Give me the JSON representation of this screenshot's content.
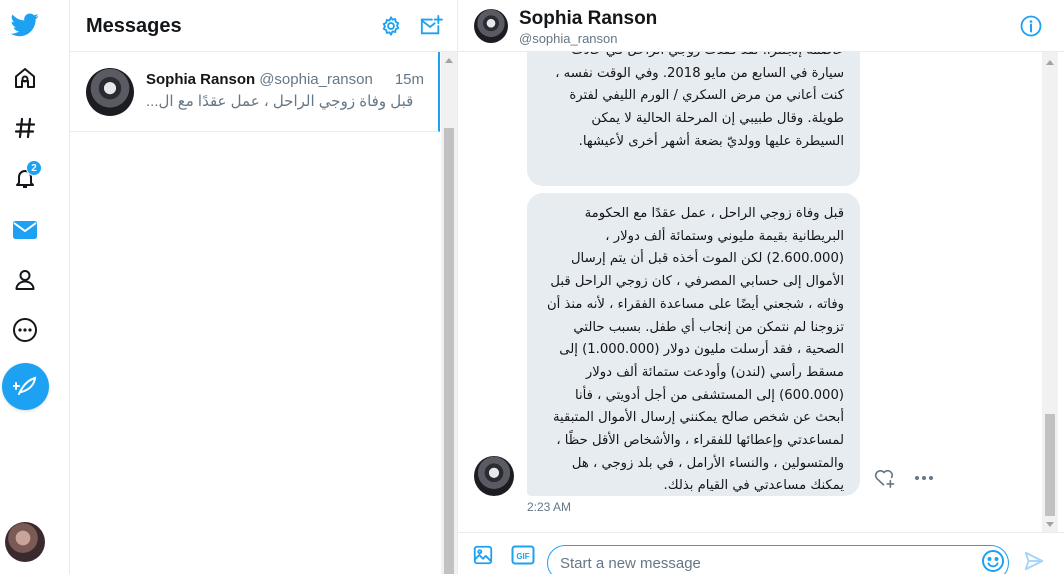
{
  "nav": {
    "items": [
      {
        "icon": "twitter-logo-icon"
      },
      {
        "icon": "home-icon"
      },
      {
        "icon": "hashtag-explore-icon"
      },
      {
        "icon": "notifications-bell-icon",
        "badge": "2"
      },
      {
        "icon": "messages-envelope-icon"
      },
      {
        "icon": "profile-person-icon"
      },
      {
        "icon": "more-options-icon"
      }
    ],
    "compose_icon": "compose-tweet-icon"
  },
  "list": {
    "title": "Messages",
    "settings_icon": "gear-icon",
    "new_message_icon": "new-message-icon"
  },
  "conversation": {
    "name": "Sophia Ranson",
    "handle": "@sophia_ranson",
    "time": "15m",
    "preview": "قبل وفاة زوجي الراحل ، عمل عقدًا مع ال..."
  },
  "chat": {
    "name": "Sophia Ranson",
    "handle": "@sophia_ranson",
    "info_icon": "info-icon",
    "messages": [
      {
        "text": "عاصمة إنجلترا. لقد فقدت زوجي الراحل في حادث سيارة في السابع من مايو 2018. وفي الوقت نفسه ، كنت أعاني من مرض السكري / الورم الليفي لفترة طويلة. وقال طبيبي إن المرحلة الحالية لا يمكن السيطرة عليها وولديّ بضعة أشهر أخرى لأعيشها."
      },
      {
        "text": "قبل وفاة زوجي الراحل ، عمل عقدًا مع الحكومة البريطانية بقيمة مليوني وستمائة ألف دولار ، (2.600.000) لكن الموت أخذه قبل أن يتم إرسال الأموال إلى حسابي المصرفي ، كان زوجي الراحل قبل وفاته ، شجعني أيضًا على مساعدة الفقراء ، لأنه منذ أن تزوجنا لم نتمكن من إنجاب أي طفل. بسبب حالتي الصحية ، فقد أرسلت مليون دولار (1.000.000) إلى مسقط رأسي (لندن) وأودعت ستمائة ألف دولار (600.000) إلى المستشفى من أجل أدويتي ، فأنا أبحث عن شخص صالح يمكنني إرسال الأموال المتبقية لمساعدتي وإعطائها للفقراء ، والأشخاص الأقل حظًا ، والمتسولين ، والنساء الأرامل ، في بلد زوجي ، هل يمكنك مساعدتي في القيام بذلك.",
        "timestamp": "2:23 AM"
      }
    ]
  },
  "composer": {
    "placeholder": "Start a new message",
    "image_icon": "image-icon",
    "gif_label": "GIF",
    "emoji_icon": "emoji-icon",
    "send_icon": "send-icon"
  },
  "colors": {
    "accent": "#1da1f2",
    "bubble": "#e6ecf0",
    "text": "#14171a",
    "muted": "#657786"
  }
}
